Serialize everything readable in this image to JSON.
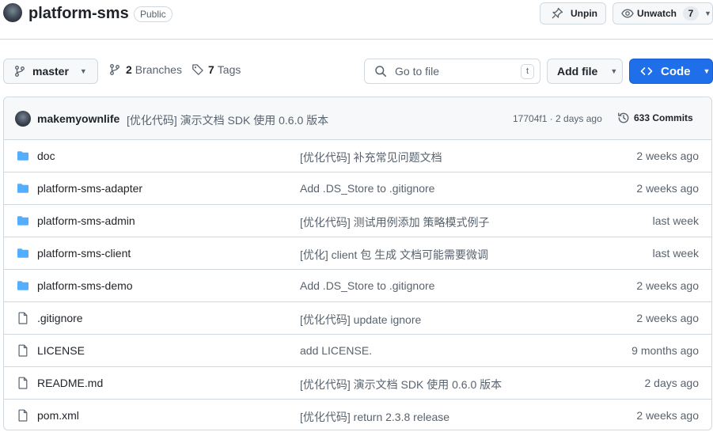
{
  "repo": {
    "name": "platform-sms",
    "visibility": "Public",
    "unpin_label": "Unpin",
    "unwatch_label": "Unwatch",
    "watch_count": "7"
  },
  "toolbar": {
    "branch": "master",
    "branches_count": "2",
    "branches_label": "Branches",
    "tags_count": "7",
    "tags_label": "Tags",
    "search_placeholder": "Go to file",
    "search_shortcut": "t",
    "add_file_label": "Add file",
    "code_label": "Code"
  },
  "commit": {
    "author": "makemyownlife",
    "message": "[优化代码] 演示文档 SDK 使用 0.6.0 版本",
    "hash_age": "17704f1 · 2 days ago",
    "commits_label": "633 Commits"
  },
  "files": [
    {
      "type": "folder",
      "name": "doc",
      "message": "[优化代码] 补充常见问题文档",
      "date": "2 weeks ago"
    },
    {
      "type": "folder",
      "name": "platform-sms-adapter",
      "message": "Add .DS_Store to .gitignore",
      "date": "2 weeks ago"
    },
    {
      "type": "folder",
      "name": "platform-sms-admin",
      "message": "[优化代码] 测试用例添加 策略模式例子",
      "date": "last week"
    },
    {
      "type": "folder",
      "name": "platform-sms-client",
      "message": "[优化] client 包 生成 文档可能需要微调",
      "date": "last week"
    },
    {
      "type": "folder",
      "name": "platform-sms-demo",
      "message": "Add .DS_Store to .gitignore",
      "date": "2 weeks ago"
    },
    {
      "type": "file",
      "name": ".gitignore",
      "message": "[优化代码] update ignore",
      "date": "2 weeks ago"
    },
    {
      "type": "file",
      "name": "LICENSE",
      "message": "add LICENSE.",
      "date": "9 months ago"
    },
    {
      "type": "file",
      "name": "README.md",
      "message": "[优化代码] 演示文档 SDK 使用 0.6.0 版本",
      "date": "2 days ago"
    },
    {
      "type": "file",
      "name": "pom.xml",
      "message": "[优化代码] return 2.3.8 release",
      "date": "2 weeks ago"
    }
  ],
  "colors": {
    "accent": "#1f6feb",
    "folder": "#54aeff",
    "muted": "#59636e"
  }
}
